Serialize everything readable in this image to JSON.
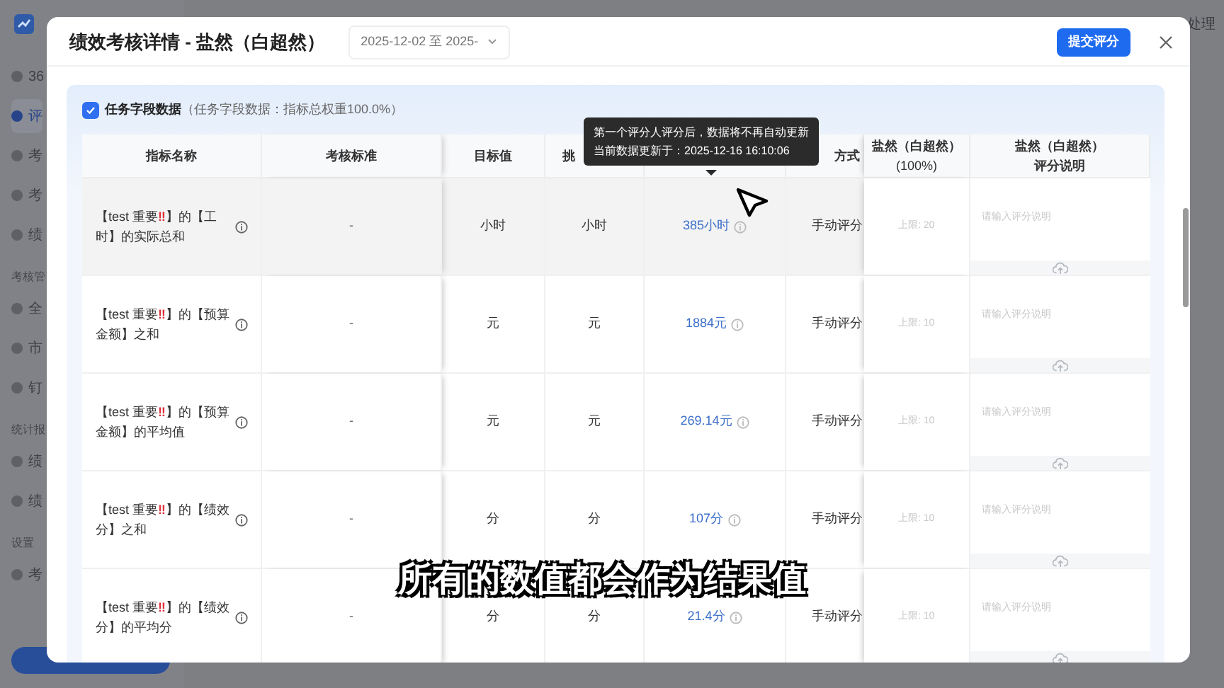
{
  "background_app": {
    "sidebar_items": [
      {
        "label": "36",
        "selected": false
      },
      {
        "label": "评",
        "selected": true
      },
      {
        "label": "考",
        "selected": false
      },
      {
        "label": "考",
        "selected": false
      },
      {
        "label": "绩",
        "selected": false
      }
    ],
    "sidebar_groups": [
      {
        "title": "考核管",
        "items": [
          "全",
          "市",
          "钉"
        ]
      },
      {
        "title": "统计报",
        "items": [
          "绩",
          "绩"
        ]
      },
      {
        "title": "设置",
        "items": [
          "考"
        ]
      }
    ],
    "header_text": "处理"
  },
  "dialog": {
    "title": "绩效考核详情 - 盐然（白超然）",
    "date_range": "2025-12-02 至 2025-",
    "submit_button": "提交评分"
  },
  "section": {
    "checked": true,
    "title": "任务字段数据",
    "subtitle": "（任务字段数据：指标总权重100.0%）"
  },
  "table": {
    "columns": [
      {
        "lines": [
          "指标名称"
        ]
      },
      {
        "lines": [
          "考核标准"
        ]
      },
      {
        "lines": [
          "目标值"
        ]
      },
      {
        "lines": [
          "挑"
        ]
      },
      {
        "lines": [
          "方式"
        ]
      },
      {
        "lines": [
          "盐然（白超然）",
          "(100%)"
        ]
      },
      {
        "lines": [
          "盐然（白超然）",
          "评分说明"
        ]
      }
    ],
    "tooltip": {
      "lines": [
        "第一个评分人评分后，数据将不再自动更新",
        "当前数据更新于：2025-12-16 16:10:06"
      ]
    },
    "rows": [
      {
        "name_start": "【test 重要",
        "flag": "‼",
        "name_end": "】的【工时】的实际总和",
        "standard": "-",
        "target": "小时",
        "challenge": "小时",
        "value": "385小时",
        "method": "手动评分",
        "score_placeholder": "上限: 20",
        "note_placeholder": "请输入评分说明",
        "highlighted": true
      },
      {
        "name_start": "【test 重要",
        "flag": "‼",
        "name_end": "】的【预算金额】之和",
        "standard": "-",
        "target": "元",
        "challenge": "元",
        "value": "1884元",
        "method": "手动评分",
        "score_placeholder": "上限: 10",
        "note_placeholder": "请输入评分说明",
        "highlighted": false
      },
      {
        "name_start": "【test 重要",
        "flag": "‼",
        "name_end": "】的【预算金额】的平均值",
        "standard": "-",
        "target": "元",
        "challenge": "元",
        "value": "269.14元",
        "method": "手动评分",
        "score_placeholder": "上限: 10",
        "note_placeholder": "请输入评分说明",
        "highlighted": false
      },
      {
        "name_start": "【test 重要",
        "flag": "‼",
        "name_end": "】的【绩效分】之和",
        "standard": "-",
        "target": "分",
        "challenge": "分",
        "value": "107分",
        "method": "手动评分",
        "score_placeholder": "上限: 10",
        "note_placeholder": "请输入评分说明",
        "highlighted": false
      },
      {
        "name_start": "【test 重要",
        "flag": "‼",
        "name_end": "】的【绩效分】的平均分",
        "standard": "-",
        "target": "分",
        "challenge": "分",
        "value": "21.4分",
        "method": "手动评分",
        "score_placeholder": "上限: 10",
        "note_placeholder": "请输入评分说明",
        "highlighted": false
      }
    ]
  },
  "caption": "所有的数值都会作为结果值"
}
